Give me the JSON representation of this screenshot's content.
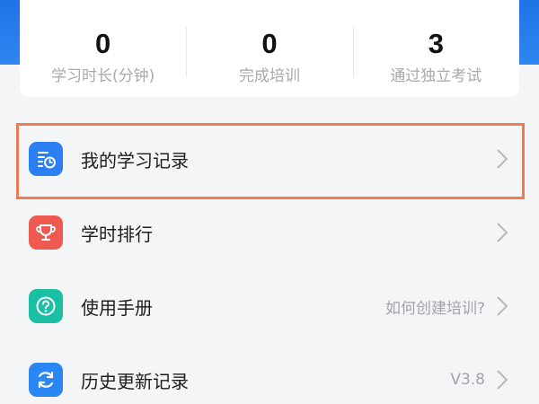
{
  "stats": [
    {
      "value": "0",
      "label": "学习时长(分钟)"
    },
    {
      "value": "0",
      "label": "完成培训"
    },
    {
      "value": "3",
      "label": "通过独立考试"
    }
  ],
  "menu": [
    {
      "label": "我的学习记录",
      "extra": "",
      "icon": "study-record-icon",
      "color": "#2b7ff2"
    },
    {
      "label": "学时排行",
      "extra": "",
      "icon": "trophy-icon",
      "color": "#ee5a4f"
    },
    {
      "label": "使用手册",
      "extra": "如何创建培训?",
      "icon": "help-icon",
      "color": "#1bc0a4"
    },
    {
      "label": "历史更新记录",
      "extra": "V3.8",
      "icon": "refresh-icon",
      "color": "#2a86f3"
    }
  ],
  "colors": {
    "header_blue": "#1f73e6",
    "highlight_orange": "#f07b52"
  }
}
